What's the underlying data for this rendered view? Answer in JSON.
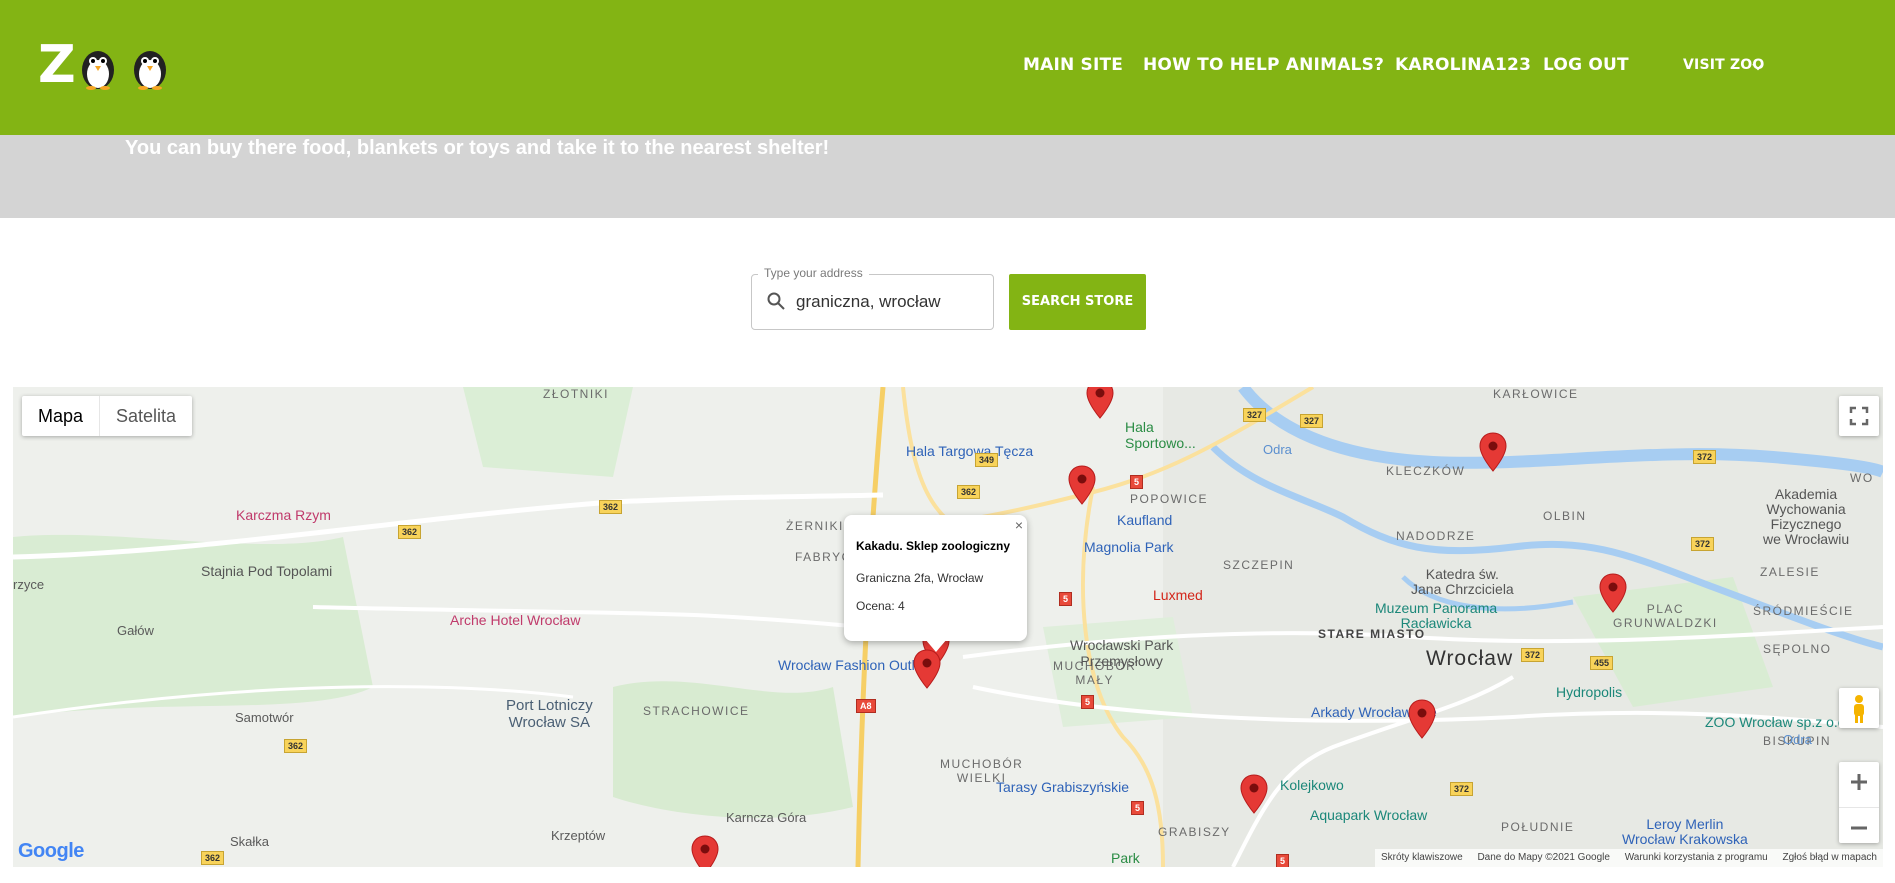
{
  "brand": {
    "logo_letter": "Z"
  },
  "nav": {
    "main_site": "MAIN SITE",
    "how_to_help": "HOW TO HELP ANIMALS?",
    "username": "KAROLINA123",
    "log_out": "LOG OUT",
    "visit_zoo": "VISIT ZOO"
  },
  "banner": {
    "text": "You can buy there food, blankets or toys and take it to the nearest shelter!"
  },
  "search": {
    "legend": "Type your address",
    "value": "graniczna, wrocław",
    "button": "SEARCH STORE"
  },
  "map": {
    "type_map": "Mapa",
    "type_satellite": "Satelita",
    "city": "Wrocław",
    "labels": {
      "zlotniki": "ZŁOTNIKI",
      "karlowice": "KARŁOWICE",
      "karczma": "Karczma Rzym",
      "krzyce": "rzyce",
      "stajnia": "Stajnia Pod Topolami",
      "galow": "Gałów",
      "arche": "Arche Hotel Wrocław",
      "samotwor": "Samotwór",
      "skalka": "Skałka",
      "krzeptow": "Krzeptów",
      "karncza": "Karncza Góra",
      "airport": "Port Lotniczy\nWrocław SA",
      "strachowice": "STRACHOWICE",
      "zerniki": "ŻERNIKI",
      "fabryczna": "FABRYCZ",
      "outlet": "Wrocław Fashion Outlet",
      "muchobor_wielki": "MUCHOBÓR\nWIELKI",
      "muchobor_maly": "MUCHOBÓR\nMAŁY",
      "hala_targowa": "Hala Targowa Tęcza",
      "hala_sport": "Hala\nSportowo...",
      "popowice": "POPOWICE",
      "kaufland": "Kaufland",
      "magnolia": "Magnolia Park",
      "nadodrze": "NADODRZE",
      "kleczkow": "KLECZKÓW",
      "olbin": "OLBIN",
      "szczepin": "SZCZEPIN",
      "luxmed": "Luxmed",
      "park_przem": "Wrocławski Park\nPrzemysłowy",
      "stare_miasto": "STARE MIASTO",
      "katedra": "Katedra św.\nJana Chrzciciela",
      "panorama": "Muzeum Panorama\nRacławicka",
      "plac": "PLAC\nGRUNWALDZKI",
      "zalesie": "ZALESIE",
      "srodmiescie": "ŚRÓDMIEŚCIE",
      "sepolno": "SĘPOLNO",
      "biskupin": "BISKUPIN",
      "akademia": "Akademia\nWychowania\nFizycznego\nwe Wrocławiu",
      "hydropolis": "Hydropolis",
      "zoo": "ZOO Wrocław sp.z o.o",
      "arkady": "Arkady Wrocławskie",
      "kolejkowo": "Kolejkowo",
      "aquapark": "Aquapark Wrocław",
      "poludnie": "POŁUDNIE",
      "leroy": "Leroy Merlin\nWrocław Krakowska",
      "tarasy": "Tarasy Grabiszyńskie",
      "grabiszyn": "GRABISZY",
      "park": "Park",
      "odra": "Odra",
      "wo": "WO"
    },
    "roads": [
      "362",
      "362",
      "362",
      "362",
      "349",
      "362",
      "327",
      "327",
      "372",
      "372",
      "372",
      "372",
      "455",
      "5",
      "5",
      "5",
      "5",
      "5",
      "A8"
    ],
    "info": {
      "title": "Kakadu. Sklep zoologiczny",
      "address": "Graniczna 2fa, Wrocław",
      "rating": "Ocena: 4",
      "close": "×"
    },
    "google": "Google",
    "attribution": {
      "shortcuts": "Skróty klawiszowe",
      "data": "Dane do Mapy ©2021 Google",
      "terms": "Warunki korzystania z programu",
      "report": "Zgłoś błąd w mapach"
    },
    "accent_color": "#83b414",
    "pin_color": "#e53935"
  }
}
